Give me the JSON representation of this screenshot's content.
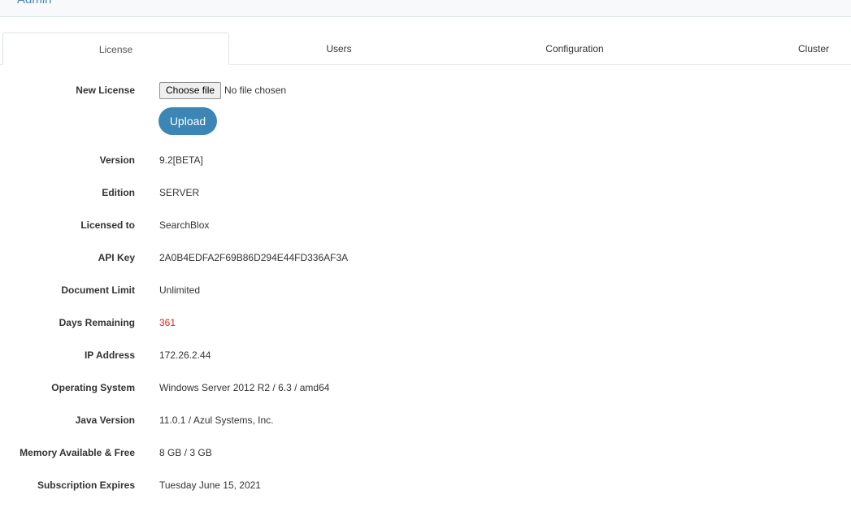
{
  "header": {
    "title": "Admin"
  },
  "tabs": [
    {
      "label": "License",
      "active": true
    },
    {
      "label": "Users"
    },
    {
      "label": "Configuration"
    },
    {
      "label": "Cluster"
    }
  ],
  "license": {
    "new_license_label": "New License",
    "choose_file_label": "Choose file",
    "no_file_text": "No file chosen",
    "upload_label": "Upload",
    "fields": [
      {
        "label": "Version",
        "value": "9.2[BETA]"
      },
      {
        "label": "Edition",
        "value": "SERVER"
      },
      {
        "label": "Licensed to",
        "value": "SearchBlox"
      },
      {
        "label": "API Key",
        "value": "2A0B4EDFA2F69B86D294E44FD336AF3A"
      },
      {
        "label": "Document Limit",
        "value": "Unlimited"
      },
      {
        "label": "Days Remaining",
        "value": "361"
      },
      {
        "label": "IP Address",
        "value": "172.26.2.44"
      },
      {
        "label": "Operating System",
        "value": "Windows Server 2012 R2 / 6.3 / amd64"
      },
      {
        "label": "Java Version",
        "value": "11.0.1 / Azul Systems, Inc."
      },
      {
        "label": "Memory Available & Free",
        "value": "8 GB / 3 GB"
      },
      {
        "label": "Subscription Expires",
        "value": "Tuesday June 15, 2021"
      }
    ]
  },
  "colors": {
    "accent": "#3b86b5",
    "days_remaining": "#d9261c"
  }
}
